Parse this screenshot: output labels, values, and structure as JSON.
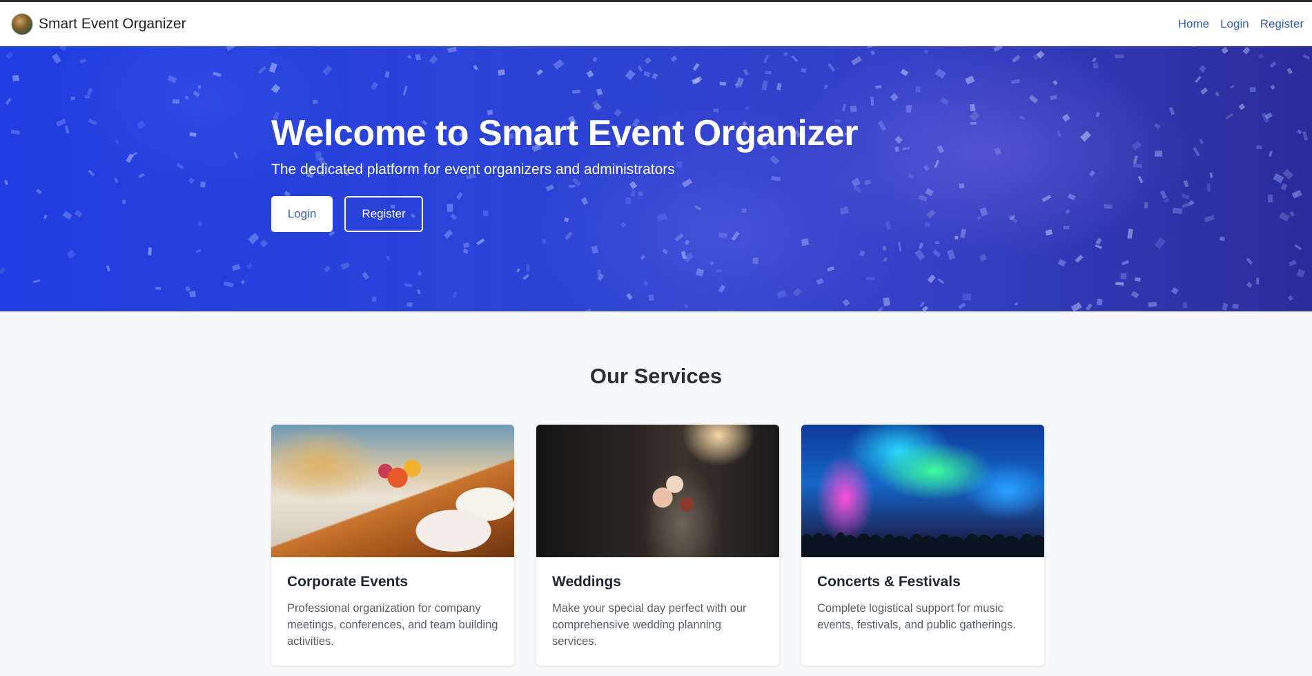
{
  "navbar": {
    "brand": "Smart Event Organizer",
    "links": [
      "Home",
      "Login",
      "Register"
    ]
  },
  "hero": {
    "title": "Welcome to Smart Event Organizer",
    "subtitle": "The dedicated platform for event organizers and administrators",
    "login_label": "Login",
    "register_label": "Register"
  },
  "services": {
    "title": "Our Services",
    "cards": [
      {
        "title": "Corporate Events",
        "text": "Professional organization for company meetings, conferences, and team building activities."
      },
      {
        "title": "Weddings",
        "text": "Make your special day perfect with our comprehensive wedding planning services."
      },
      {
        "title": "Concerts & Festivals",
        "text": "Complete logistical support for music events, festivals, and public gatherings."
      }
    ]
  },
  "colors": {
    "accent": "#2f5fb8",
    "hero_blue": "#2a43d8",
    "background": "#f6f8fa"
  }
}
